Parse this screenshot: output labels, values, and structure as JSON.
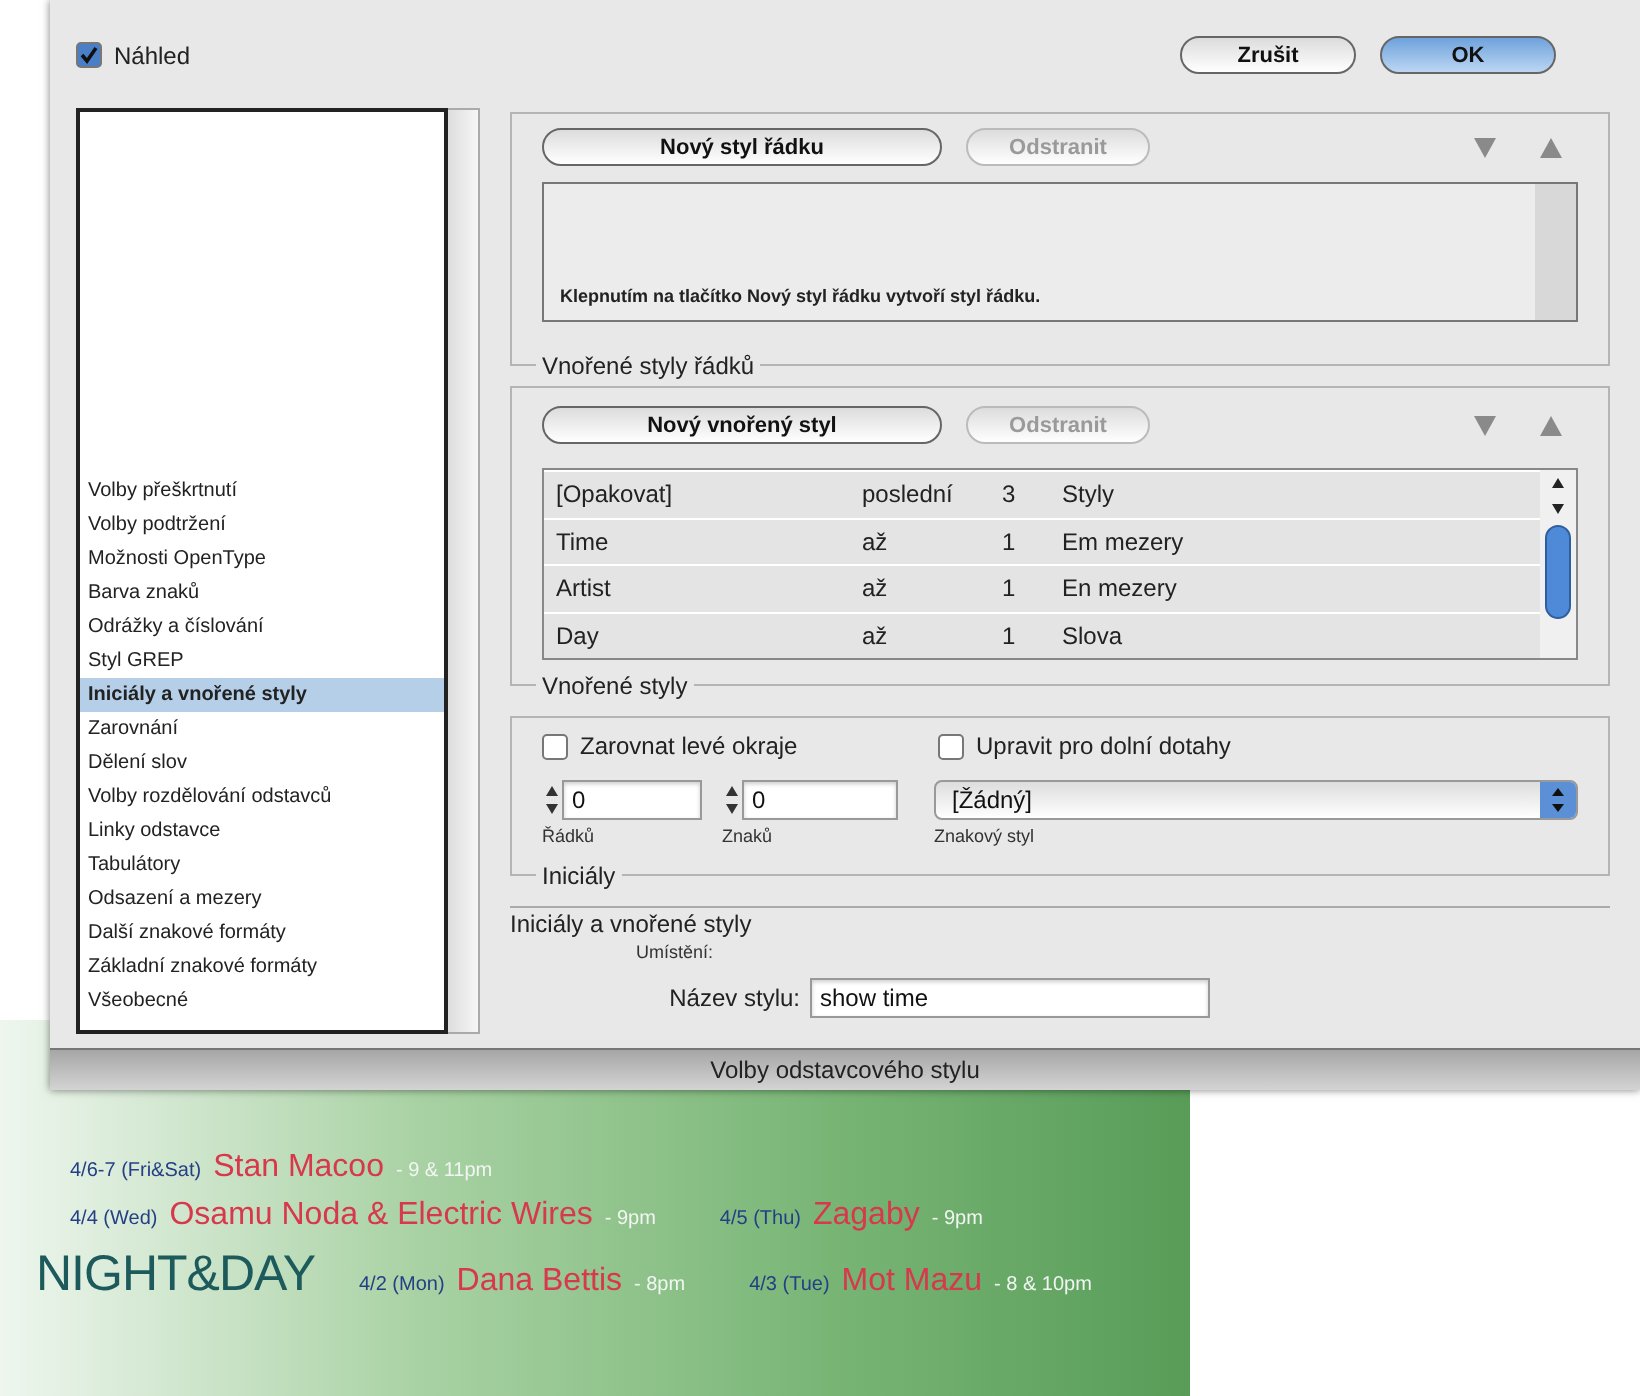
{
  "banner": {
    "title": "NIGHT&DAY",
    "lines": [
      {
        "events": [
          {
            "date": "4/6-7 (Fri&Sat)",
            "artist": "Stan Macoo",
            "time": "- 9 & 11pm"
          }
        ]
      },
      {
        "events": [
          {
            "date": "4/4 (Wed)",
            "artist": "Osamu Noda & Electric Wires",
            "time": "- 9pm"
          },
          {
            "date": "4/5 (Thu)",
            "artist": "Zagaby",
            "time": "- 9pm"
          }
        ]
      },
      {
        "events": [
          {
            "date": "4/2 (Mon)",
            "artist": "Dana Bettis",
            "time": "- 8pm"
          },
          {
            "date": "4/3 (Tue)",
            "artist": "Mot Mazu",
            "time": "- 8 & 10pm"
          }
        ]
      }
    ]
  },
  "dialog": {
    "title": "Volby odstavcového stylu",
    "sidebar": {
      "items": [
        {
          "label": "Volby přeškrtnutí",
          "selected": false
        },
        {
          "label": "Volby podtržení",
          "selected": false
        },
        {
          "label": "Možnosti OpenType",
          "selected": false
        },
        {
          "label": "Barva znaků",
          "selected": false
        },
        {
          "label": "Odrážky a číslování",
          "selected": false
        },
        {
          "label": "Styl GREP",
          "selected": false
        },
        {
          "label": "Iniciály a vnořené styly",
          "selected": true
        },
        {
          "label": "Zarovnání",
          "selected": false
        },
        {
          "label": "Dělení slov",
          "selected": false
        },
        {
          "label": "Volby rozdělování odstavců",
          "selected": false
        },
        {
          "label": "Linky odstavce",
          "selected": false
        },
        {
          "label": "Tabulátory",
          "selected": false
        },
        {
          "label": "Odsazení a mezery",
          "selected": false
        },
        {
          "label": "Další znakové formáty",
          "selected": false
        },
        {
          "label": "Základní znakové formáty",
          "selected": false
        },
        {
          "label": "Všeobecné",
          "selected": false
        }
      ]
    },
    "style_name": {
      "label": "Název stylu:",
      "value": "show time"
    },
    "location": {
      "label": "Umístění:"
    },
    "section_title": "Iniciály a vnořené styly",
    "drop_caps": {
      "legend": "Iniciály",
      "lines": {
        "label": "Řádků",
        "value": "0"
      },
      "characters": {
        "label": "Znaků",
        "value": "0"
      },
      "character_style": {
        "label": "Znakový styl",
        "value": "[Žádný]"
      },
      "checkboxes": [
        {
          "label": "Zarovnat levé okraje",
          "checked": false
        },
        {
          "label": "Upravit pro dolní dotahy",
          "checked": false
        }
      ]
    },
    "nested_styles": {
      "legend": "Vnořené styly",
      "rows": [
        {
          "column_1": "[Opakovat]",
          "column_2": "poslední",
          "column_3": "3",
          "column_4": "Styly"
        },
        {
          "column_1": "Time",
          "column_2": "až",
          "column_3": "1",
          "column_4": "Em mezery"
        },
        {
          "column_1": "Artist",
          "column_2": "až",
          "column_3": "1",
          "column_4": "En mezery"
        },
        {
          "column_1": "Day",
          "column_2": "až",
          "column_3": "1",
          "column_4": "Slova"
        }
      ],
      "buttons": [
        {
          "label": "Nový vnořený styl",
          "disabled": false
        },
        {
          "label": "Odstranit",
          "disabled": true
        }
      ]
    },
    "nested_line_styles": {
      "legend": "Vnořené styly řádků",
      "message": "Klepnutím na tlačítko Nový styl řádku vytvoří styl řádku.",
      "buttons": [
        {
          "label": "Nový styl řádku",
          "disabled": false
        },
        {
          "label": "Odstranit",
          "disabled": true
        }
      ]
    },
    "preview": {
      "label": "Náhled",
      "checked": true
    },
    "buttons": [
      {
        "label": "Zrušit",
        "default": false
      },
      {
        "label": "OK",
        "default": true
      }
    ]
  }
}
